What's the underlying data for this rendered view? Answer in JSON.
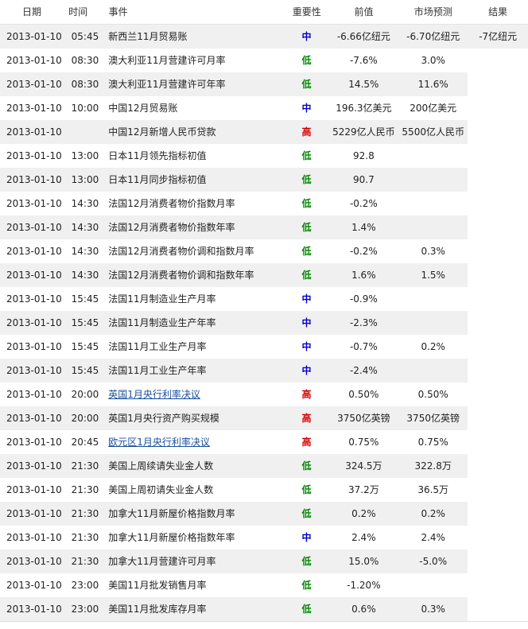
{
  "headers": {
    "date": "日期",
    "time": "时间",
    "event": "事件",
    "importance": "重要性",
    "previous": "前值",
    "forecast": "市场预测",
    "result": "结果"
  },
  "rows": [
    {
      "date": "2013-01-10",
      "time": "05:45",
      "event": "新西兰11月贸易账",
      "importance": "中",
      "level": "mid",
      "previous": "-6.66亿纽元",
      "forecast": "-6.70亿纽元",
      "result": "-7亿纽元",
      "link": false
    },
    {
      "date": "2013-01-10",
      "time": "08:30",
      "event": "澳大利亚11月营建许可月率",
      "importance": "低",
      "level": "low",
      "previous": "-7.6%",
      "forecast": "3.0%",
      "result": "",
      "link": false
    },
    {
      "date": "2013-01-10",
      "time": "08:30",
      "event": "澳大利亚11月营建许可年率",
      "importance": "低",
      "level": "low",
      "previous": "14.5%",
      "forecast": "11.6%",
      "result": "",
      "link": false
    },
    {
      "date": "2013-01-10",
      "time": "10:00",
      "event": "中国12月贸易账",
      "importance": "中",
      "level": "mid",
      "previous": "196.3亿美元",
      "forecast": "200亿美元",
      "result": "",
      "link": false
    },
    {
      "date": "2013-01-10",
      "time": "",
      "event": "中国12月新增人民币贷款",
      "importance": "高",
      "level": "high",
      "previous": "5229亿人民币",
      "forecast": "5500亿人民币",
      "result": "",
      "link": false
    },
    {
      "date": "2013-01-10",
      "time": "13:00",
      "event": "日本11月领先指标初值",
      "importance": "低",
      "level": "low",
      "previous": "92.8",
      "forecast": "",
      "result": "",
      "link": false
    },
    {
      "date": "2013-01-10",
      "time": "13:00",
      "event": "日本11月同步指标初值",
      "importance": "低",
      "level": "low",
      "previous": "90.7",
      "forecast": "",
      "result": "",
      "link": false
    },
    {
      "date": "2013-01-10",
      "time": "14:30",
      "event": "法国12月消费者物价指数月率",
      "importance": "低",
      "level": "low",
      "previous": "-0.2%",
      "forecast": "",
      "result": "",
      "link": false
    },
    {
      "date": "2013-01-10",
      "time": "14:30",
      "event": "法国12月消费者物价指数年率",
      "importance": "低",
      "level": "low",
      "previous": "1.4%",
      "forecast": "",
      "result": "",
      "link": false
    },
    {
      "date": "2013-01-10",
      "time": "14:30",
      "event": "法国12月消费者物价调和指数月率",
      "importance": "低",
      "level": "low",
      "previous": "-0.2%",
      "forecast": "0.3%",
      "result": "",
      "link": false
    },
    {
      "date": "2013-01-10",
      "time": "14:30",
      "event": "法国12月消费者物价调和指数年率",
      "importance": "低",
      "level": "low",
      "previous": "1.6%",
      "forecast": "1.5%",
      "result": "",
      "link": false
    },
    {
      "date": "2013-01-10",
      "time": "15:45",
      "event": "法国11月制造业生产月率",
      "importance": "中",
      "level": "mid",
      "previous": "-0.9%",
      "forecast": "",
      "result": "",
      "link": false
    },
    {
      "date": "2013-01-10",
      "time": "15:45",
      "event": "法国11月制造业生产年率",
      "importance": "中",
      "level": "mid",
      "previous": "-2.3%",
      "forecast": "",
      "result": "",
      "link": false
    },
    {
      "date": "2013-01-10",
      "time": "15:45",
      "event": "法国11月工业生产月率",
      "importance": "中",
      "level": "mid",
      "previous": "-0.7%",
      "forecast": "0.2%",
      "result": "",
      "link": false
    },
    {
      "date": "2013-01-10",
      "time": "15:45",
      "event": "法国11月工业生产年率",
      "importance": "中",
      "level": "mid",
      "previous": "-2.4%",
      "forecast": "",
      "result": "",
      "link": false
    },
    {
      "date": "2013-01-10",
      "time": "20:00",
      "event": "英国1月央行利率决议",
      "importance": "高",
      "level": "high",
      "previous": "0.50%",
      "forecast": "0.50%",
      "result": "",
      "link": true
    },
    {
      "date": "2013-01-10",
      "time": "20:00",
      "event": "英国1月央行资产购买规模",
      "importance": "高",
      "level": "high",
      "previous": "3750亿英镑",
      "forecast": "3750亿英镑",
      "result": "",
      "link": false
    },
    {
      "date": "2013-01-10",
      "time": "20:45",
      "event": "欧元区1月央行利率决议",
      "importance": "高",
      "level": "high",
      "previous": "0.75%",
      "forecast": "0.75%",
      "result": "",
      "link": true
    },
    {
      "date": "2013-01-10",
      "time": "21:30",
      "event": "美国上周续请失业金人数",
      "importance": "低",
      "level": "low",
      "previous": "324.5万",
      "forecast": "322.8万",
      "result": "",
      "link": false
    },
    {
      "date": "2013-01-10",
      "time": "21:30",
      "event": "美国上周初请失业金人数",
      "importance": "低",
      "level": "low",
      "previous": "37.2万",
      "forecast": "36.5万",
      "result": "",
      "link": false
    },
    {
      "date": "2013-01-10",
      "time": "21:30",
      "event": "加拿大11月新屋价格指数月率",
      "importance": "低",
      "level": "low",
      "previous": "0.2%",
      "forecast": "0.2%",
      "result": "",
      "link": false
    },
    {
      "date": "2013-01-10",
      "time": "21:30",
      "event": "加拿大11月新屋价格指数年率",
      "importance": "中",
      "level": "mid",
      "previous": "2.4%",
      "forecast": "2.4%",
      "result": "",
      "link": false
    },
    {
      "date": "2013-01-10",
      "time": "21:30",
      "event": "加拿大11月营建许可月率",
      "importance": "低",
      "level": "low",
      "previous": "15.0%",
      "forecast": "-5.0%",
      "result": "",
      "link": false
    },
    {
      "date": "2013-01-10",
      "time": "23:00",
      "event": "美国11月批发销售月率",
      "importance": "低",
      "level": "low",
      "previous": "-1.20%",
      "forecast": "",
      "result": "",
      "link": false
    },
    {
      "date": "2013-01-10",
      "time": "23:00",
      "event": "美国11月批发库存月率",
      "importance": "低",
      "level": "low",
      "previous": "0.6%",
      "forecast": "0.3%",
      "result": "",
      "link": false
    }
  ],
  "colors": {
    "high": "#d40000",
    "mid": "#0000cc",
    "low": "#008800",
    "link": "#1a4f9c",
    "stripe": "#f0f0f0"
  }
}
